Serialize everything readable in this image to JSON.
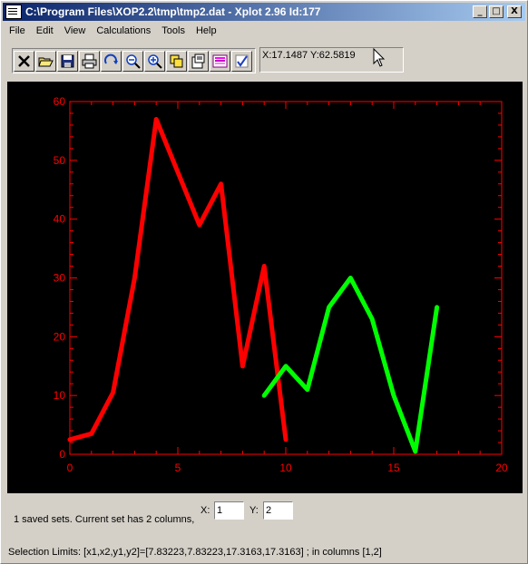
{
  "window": {
    "title": "C:\\Program Files\\XOP2.2\\tmp\\tmp2.dat - Xplot 2.96 Id:177",
    "controls": [
      "_",
      "□",
      "X"
    ]
  },
  "menu": [
    "File",
    "Edit",
    "View",
    "Calculations",
    "Tools",
    "Help"
  ],
  "toolbar": {
    "icons": [
      "close-icon",
      "open-folder-icon",
      "save-icon",
      "print-icon",
      "redraw-icon",
      "zoom-out-icon",
      "zoom-in-icon",
      "copy-icon",
      "paste-settings-icon",
      "palette-icon",
      "check-icon"
    ]
  },
  "coords_text": "X:17.1487 Y:62.5819",
  "status": {
    "sets_text": "1  saved sets. Current set has  2  columns,",
    "x_label": "X:",
    "x_value": "1",
    "y_label": "Y:",
    "y_value": "2",
    "selection_text": "Selection Limits: [x1,x2,y1,y2]=[7.83223,7.83223,17.3163,17.3163] ; in columns [1,2]"
  },
  "colors": {
    "axis": "#ff0000",
    "background": "#000000",
    "series1": "#ff0000",
    "series2": "#00ff00"
  },
  "chart_data": {
    "type": "line",
    "xlim": [
      0,
      20
    ],
    "ylim": [
      0,
      60
    ],
    "xticks": [
      0,
      5,
      10,
      15,
      20
    ],
    "yticks": [
      0,
      10,
      20,
      30,
      40,
      50,
      60
    ],
    "grid": false,
    "series": [
      {
        "color": "#ff0000",
        "x": [
          0,
          1,
          2,
          3,
          4,
          5,
          6,
          7,
          8,
          9,
          10
        ],
        "y": [
          2.5,
          3.5,
          10.5,
          30,
          57,
          48,
          39,
          46,
          15,
          32,
          2.5
        ]
      },
      {
        "color": "#00ff00",
        "x": [
          9,
          10,
          11,
          12,
          13,
          14,
          15,
          16,
          17
        ],
        "y": [
          10,
          15,
          11,
          25,
          30,
          23,
          10,
          0.5,
          25
        ]
      }
    ]
  }
}
